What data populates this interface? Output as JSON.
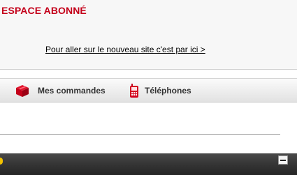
{
  "header": {
    "title": "ESPACE ABONNÉ",
    "new_site_link": "Pour aller sur le nouveau site c'est par ici >"
  },
  "nav": {
    "items": [
      {
        "label": "Mes commandes",
        "icon": "orders-box-icon"
      },
      {
        "label": "Téléphones",
        "icon": "mobile-phone-icon"
      }
    ]
  },
  "colors": {
    "brand_red": "#c4001a",
    "bottom_bar": "#333333"
  }
}
